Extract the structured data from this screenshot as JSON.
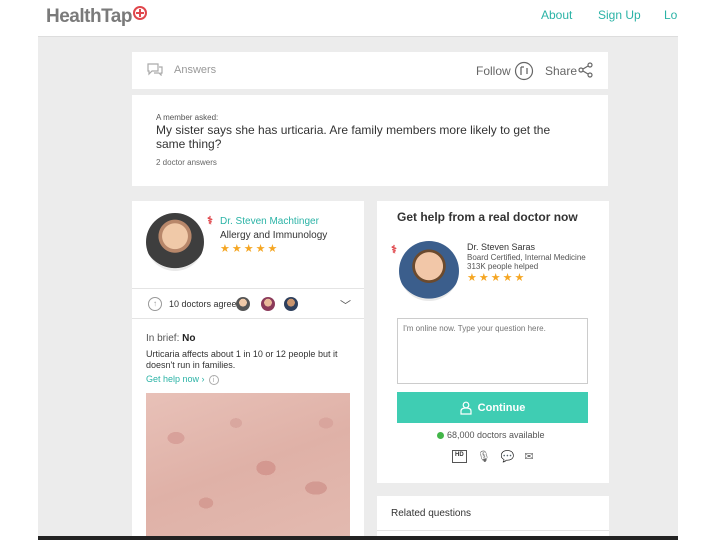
{
  "header": {
    "logo_text": "HealthTap",
    "nav": [
      {
        "label": "About"
      },
      {
        "label": "Sign Up"
      },
      {
        "label": "Lo"
      }
    ]
  },
  "answers_bar": {
    "label": "Answers",
    "follow_label": "Follow",
    "share_label": "Share"
  },
  "question": {
    "asked_by": "A member asked:",
    "text": "My sister says she has urticaria. Are family members more likely to get the same thing?",
    "count": "2 doctor answers"
  },
  "answer": {
    "doctor_name": "Dr. Steven Machtinger",
    "specialty": "Allergy and Immunology",
    "stars": "★★★★★",
    "agree_text": "10 doctors agree",
    "brief_label": "In brief:",
    "brief_value": "No",
    "brief_body": "Urticaria affects about 1 in 10 or 12 people but it doesn't run in families.",
    "get_help": "Get help now ›"
  },
  "help": {
    "title": "Get help from a real doctor now",
    "doctor_name": "Dr. Steven Saras",
    "doctor_cert": "Board Certified, Internal Medicine",
    "doctor_helped": "313K people helped",
    "stars": "★★★★★",
    "placeholder": "I'm online now. Type your question here.",
    "continue_label": "Continue",
    "available": "68,000 doctors available"
  },
  "related": {
    "title": "Related questions"
  },
  "colors": {
    "accent": "#2bb3a6",
    "button": "#3fcdb3",
    "star": "#f5a623",
    "brand_red": "#e0474c"
  }
}
